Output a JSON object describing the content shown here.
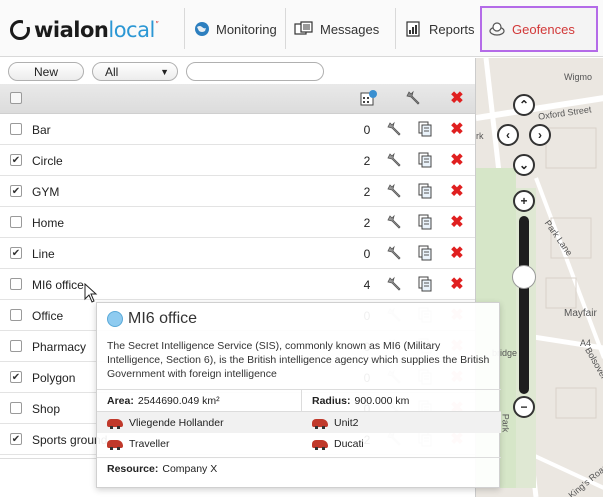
{
  "nav": {
    "logo": {
      "primary": "wialon",
      "secondary": "local",
      "mark": "″"
    },
    "tabs": [
      {
        "label": "Monitoring",
        "icon": "globe-icon"
      },
      {
        "label": "Messages",
        "icon": "messages-icon"
      },
      {
        "label": "Reports",
        "icon": "reports-icon"
      },
      {
        "label": "Geofences",
        "icon": "geofence-icon",
        "active": true
      }
    ]
  },
  "toolbar": {
    "new_label": "New",
    "filter_value": "All",
    "search_value": ""
  },
  "list": {
    "rows": [
      {
        "name": "Bar",
        "checked": false,
        "count": "0"
      },
      {
        "name": "Circle",
        "checked": true,
        "count": "2"
      },
      {
        "name": "GYM",
        "checked": true,
        "count": "2"
      },
      {
        "name": "Home",
        "checked": false,
        "count": "2"
      },
      {
        "name": "Line",
        "checked": true,
        "count": "0"
      },
      {
        "name": "MI6 office",
        "checked": false,
        "count": "4"
      },
      {
        "name": "Office",
        "checked": false,
        "count": "0"
      },
      {
        "name": "Pharmacy",
        "checked": false,
        "count": "0"
      },
      {
        "name": "Polygon",
        "checked": true,
        "count": "0"
      },
      {
        "name": "Shop",
        "checked": false,
        "count": "0"
      },
      {
        "name": "Sports ground",
        "checked": true,
        "count": "2"
      }
    ]
  },
  "popup": {
    "title": "MI6 office",
    "description": "The Secret Intelligence Service (SIS), commonly known as MI6 (Military Intelligence, Section 6), is the British intelligence agency which supplies the British Government with foreign intelligence",
    "area_label": "Area:",
    "area_value": "2544690.049 km²",
    "radius_label": "Radius:",
    "radius_value": "900.000 km",
    "units": [
      "Vliegende Hollander",
      "Unit2",
      "Traveller",
      "Ducati"
    ],
    "resource_label": "Resource:",
    "resource_value": "Company X"
  },
  "map": {
    "labels": [
      "Wigmo",
      "Oxford Street",
      "rk",
      "Park Lane",
      "Mayfair",
      "A4",
      "bridge",
      "Bolsover St",
      "Park",
      "King's Road"
    ]
  },
  "colors": {
    "accent": "#d23838",
    "active_border": "#b46be8",
    "delete": "#e02020",
    "logo_blue": "#2b97d4"
  }
}
